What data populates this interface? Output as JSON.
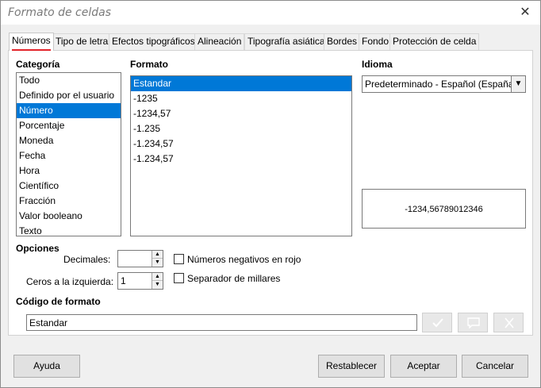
{
  "window": {
    "title": "Formato de celdas",
    "close_glyph": "✕"
  },
  "tabs": [
    {
      "label": "Números",
      "active": true
    },
    {
      "label": "Tipo de letra"
    },
    {
      "label": "Efectos tipográficos"
    },
    {
      "label": "Alineación"
    },
    {
      "label": "Tipografía asiática"
    },
    {
      "label": "Bordes"
    },
    {
      "label": "Fondo"
    },
    {
      "label": "Protección de celda"
    }
  ],
  "categoria": {
    "label": "Categoría",
    "items": [
      "Todo",
      "Definido por el usuario",
      "Número",
      "Porcentaje",
      "Moneda",
      "Fecha",
      "Hora",
      "Científico",
      "Fracción",
      "Valor booleano",
      "Texto"
    ],
    "selected": "Número"
  },
  "formato": {
    "label": "Formato",
    "items": [
      "Estandar",
      "-1235",
      "-1234,57",
      "-1.235",
      "-1.234,57",
      "-1.234,57"
    ],
    "selected": "Estandar"
  },
  "idioma": {
    "label": "Idioma",
    "value": "Predeterminado - Español (España)"
  },
  "preview": {
    "value": "-1234,56789012346"
  },
  "opciones": {
    "label": "Opciones",
    "decimales_label": "Decimales:",
    "decimales_value": "",
    "ceros_label": "Ceros a la izquierda:",
    "ceros_value": "1",
    "negativos_rojo": {
      "label": "Números negativos en rojo",
      "checked": false
    },
    "separador": {
      "label": "Separador de millares",
      "checked": false
    }
  },
  "codigo": {
    "label": "Código de formato",
    "value": "Estandar"
  },
  "buttons": {
    "ayuda": "Ayuda",
    "restablecer": "Restablecer",
    "aceptar": "Aceptar",
    "cancelar": "Cancelar"
  },
  "icons": {
    "accept": "checkmark-icon",
    "comment": "comment-icon",
    "delete": "delete-icon"
  }
}
